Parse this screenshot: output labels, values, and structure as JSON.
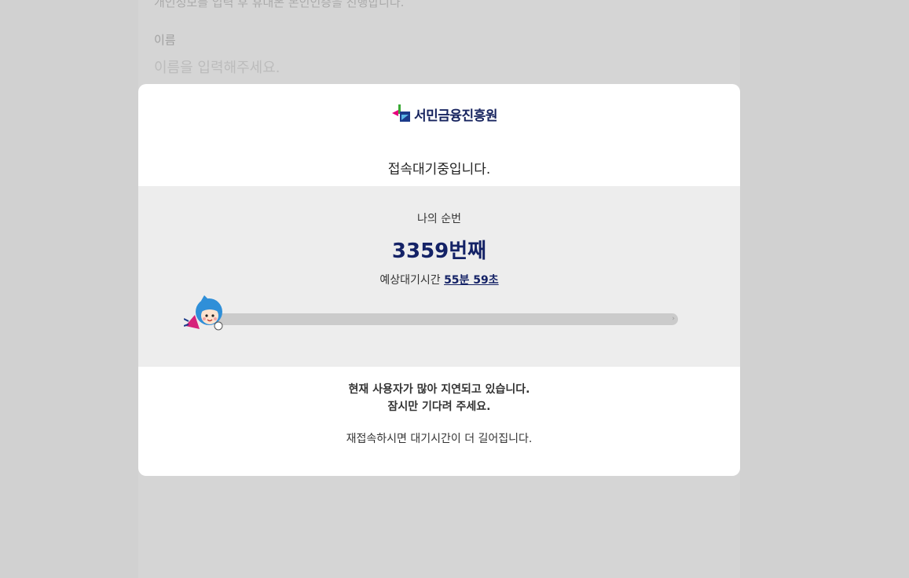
{
  "background": {
    "notice": "개인정보를 입력 후 휴대폰 본인인증을 진행합니다.",
    "name_label": "이름",
    "name_placeholder": "이름을 입력해주세요."
  },
  "modal": {
    "logo_text": "서민금융진흥원",
    "status_title": "접속대기중입니다.",
    "queue_label": "나의 순번",
    "queue_number": "3359번째",
    "wait_label": "예상대기시간",
    "wait_time": "55분 59초",
    "progress_fraction": 0.0,
    "progress_end_glyph": "›",
    "message_line1": "현재 사용자가 많아 지연되고 있습니다.",
    "message_line2": "잠시만 기다려 주세요.",
    "reconnect_note": "재접속하시면 대기시간이 더 길어집니다."
  },
  "colors": {
    "brand_navy": "#142266",
    "panel_gray": "#ededed",
    "track_gray": "#cbcbcb"
  }
}
